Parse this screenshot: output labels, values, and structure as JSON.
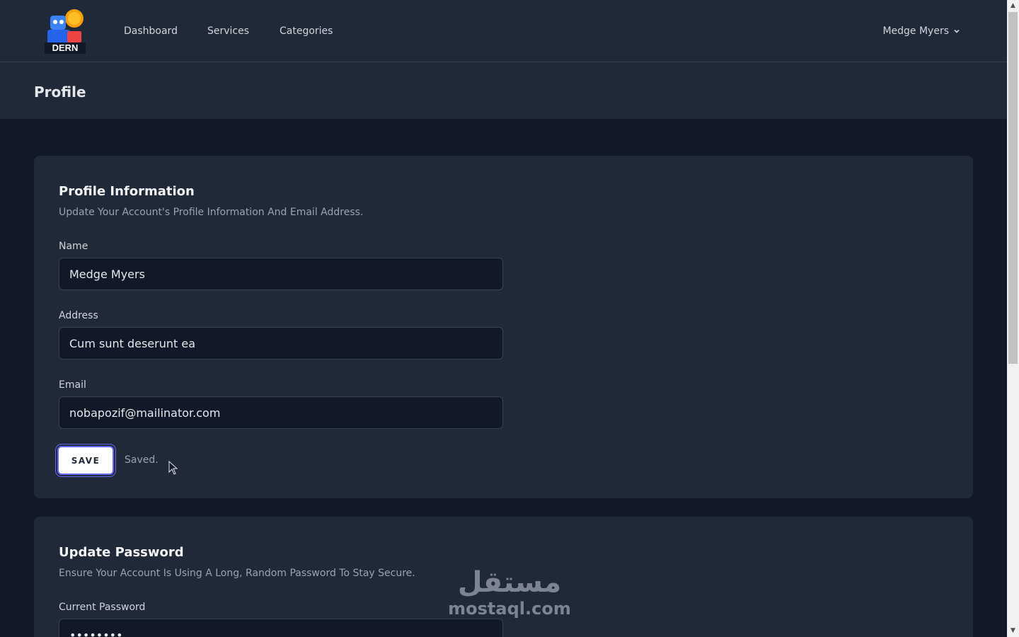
{
  "nav": {
    "logo_text": "DERN",
    "links": [
      "Dashboard",
      "Services",
      "Categories"
    ],
    "user_name": "Medge Myers"
  },
  "header": {
    "title": "Profile"
  },
  "profile_info": {
    "title": "Profile Information",
    "description": "Update Your Account's Profile Information And Email Address.",
    "name_label": "Name",
    "name_value": "Medge Myers",
    "address_label": "Address",
    "address_value": "Cum sunt deserunt ea",
    "email_label": "Email",
    "email_value": "nobapozif@mailinator.com",
    "save_label": "SAVE",
    "saved_message": "Saved."
  },
  "update_password": {
    "title": "Update Password",
    "description": "Ensure Your Account Is Using A Long, Random Password To Stay Secure.",
    "current_password_label": "Current Password",
    "current_password_value": "••••••••"
  },
  "watermark": {
    "arabic": "مستقل",
    "latin": "mostaql.com"
  },
  "colors": {
    "background": "#111827",
    "surface": "#1f2937",
    "focus_ring": "#6366f1"
  }
}
